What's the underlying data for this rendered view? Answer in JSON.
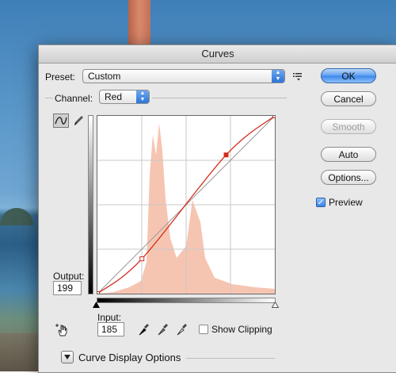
{
  "window": {
    "title": "Curves"
  },
  "preset": {
    "label": "Preset:",
    "value": "Custom"
  },
  "channel": {
    "label": "Channel:",
    "value": "Red"
  },
  "buttons": {
    "ok": "OK",
    "cancel": "Cancel",
    "smooth": "Smooth",
    "auto": "Auto",
    "options": "Options..."
  },
  "preview": {
    "label": "Preview",
    "checked": true
  },
  "output": {
    "label": "Output:",
    "value": "199"
  },
  "input": {
    "label": "Input:",
    "value": "185"
  },
  "show_clipping": {
    "label": "Show Clipping",
    "checked": false
  },
  "curve_display": {
    "label": "Curve Display Options"
  },
  "curve": {
    "color": "#d42a1a",
    "points": [
      [
        0,
        0
      ],
      [
        64,
        50
      ],
      [
        185,
        199
      ],
      [
        255,
        255
      ]
    ]
  },
  "histogram_color": "#f6c5b2"
}
